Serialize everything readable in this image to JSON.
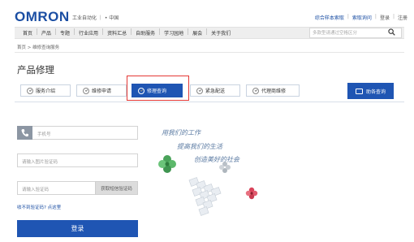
{
  "header": {
    "logo": "OMRON",
    "tagline": "工业自动化 ｜ • 中国",
    "links": [
      "综合样本索取",
      "索取询问",
      "登录",
      "注册"
    ],
    "link_sep": "|"
  },
  "nav": {
    "items": [
      "首页",
      "产品",
      "专题",
      "行业应用",
      "资料汇总",
      "自助服务",
      "学习园地",
      "展会",
      "关于我们"
    ],
    "search_placeholder": "多款型请通过空格区分"
  },
  "breadcrumb": "首页 > 维修查询服务",
  "page_title": "产品修理",
  "tabs": [
    {
      "label": "服务介绍",
      "active": false
    },
    {
      "label": "维修申请",
      "active": false
    },
    {
      "label": "修理查询",
      "active": true
    },
    {
      "label": "紧急配送",
      "active": false
    },
    {
      "label": "代理商维修",
      "active": false
    }
  ],
  "quick_button": "助各查询",
  "form": {
    "phone_placeholder": "手机号",
    "captcha_placeholder": "请输入图片验证码",
    "sms_placeholder": "请输入验证码",
    "sms_button": "获取短信验证码",
    "no_code_link": "收不到验证码? 点这里",
    "login_button": "登录"
  },
  "slogan": [
    "用我们的工作",
    "提高我们的生活",
    "创造美好的社会"
  ],
  "colors": {
    "brand": "#1f55b3",
    "highlight": "#e53935"
  }
}
